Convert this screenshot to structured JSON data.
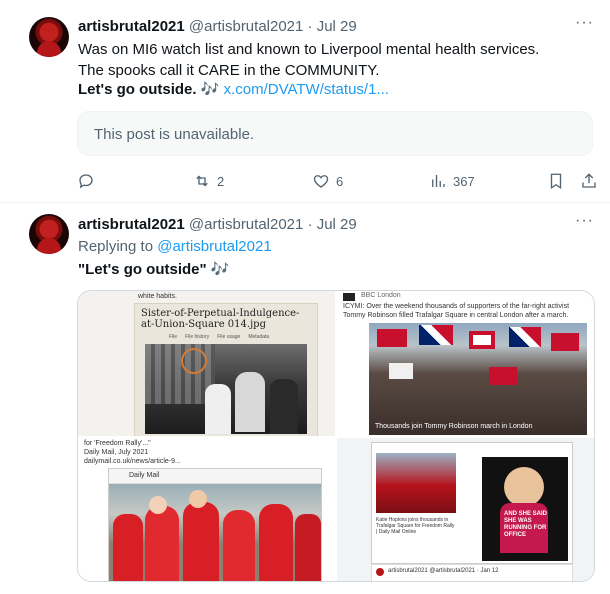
{
  "tweet1": {
    "name": "artisbrutal2021",
    "handle": "@artisbrutal2021",
    "sep": "·",
    "date": "Jul 29",
    "more": "···",
    "line1": "Was on MI6 watch list and known to Liverpool mental health services.",
    "line2": "The spooks call it CARE in the COMMUNITY.",
    "line3_bold": "Let's go outside.",
    "line3_emoji": "🎶",
    "line3_link": "x.com/DVATW/status/1...",
    "unavailable": "This post is unavailable.",
    "actions": {
      "reply_count": "",
      "repost_count": "2",
      "like_count": "6",
      "view_count": "367"
    }
  },
  "tweet2": {
    "name": "artisbrutal2021",
    "handle": "@artisbrutal2021",
    "sep": "·",
    "date": "Jul 29",
    "more": "···",
    "replying_prefix": "Replying to",
    "replying_handle": "@artisbrutal2021",
    "body_bold": "\"Let's go outside\"",
    "body_emoji": "🎶",
    "media": {
      "img1_caption": "Sister-of-Perpetual-Indulgence-at-Union-Square 014.jpg",
      "img1_top": "white habits.",
      "img1_tabs": [
        "File",
        "File history",
        "File usage",
        "Metadata"
      ],
      "img2_source": "BBC London",
      "img2_text1": "ICYMI: Over the weekend thousands of supporters of the far-right activist",
      "img2_text2": "Tommy Robinson filled Trafalgar Square in central London after a march.",
      "img2_caption": "Thousands join Tommy Robinson march in London",
      "img3_l1": "for 'Freedom Rally'...\"",
      "img3_l2": "Daily Mail, July 2021",
      "img3_l3": "dailymail.co.uk/news/article-9...",
      "img3_site": "Daily Mail",
      "img4_caption": "Katie Hopkins joins thousands in Trafalgar Square for Freedom Rally | Daily Mail Online",
      "img4_overlay": "AND SHE SAID SHE WAS RUNNING FOR OFFICE",
      "img4_footer": "artisbrutal2021 @artisbrutal2021 · Jan 12"
    }
  },
  "colors": {
    "accent": "#1d9bf0",
    "muted": "#536471",
    "text": "#0f1419"
  }
}
